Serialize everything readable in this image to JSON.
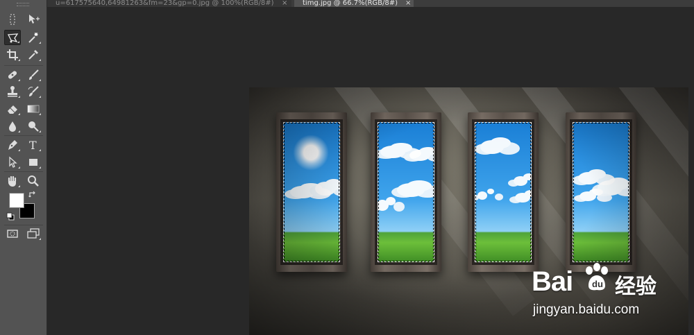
{
  "tabs": [
    {
      "label": "u=617575640,64981263&fm=23&gp=0.jpg @ 100%(RGB/8#)",
      "close": "×",
      "active": false
    },
    {
      "label": "timg.jpg @ 66.7%(RGB/8#)",
      "close": "×",
      "active": true
    }
  ],
  "tools": {
    "icons": [
      "marquee-icon",
      "move-icon",
      "polygonal-lasso-icon",
      "magic-wand-icon",
      "crop-icon",
      "eyedropper-icon",
      "spot-healing-brush-icon",
      "brush-icon",
      "clone-stamp-icon",
      "history-brush-icon",
      "eraser-icon",
      "gradient-icon",
      "blur-icon",
      "dodge-icon",
      "pen-icon",
      "type-icon",
      "path-selection-icon",
      "rectangle-shape-icon",
      "hand-icon",
      "zoom-icon",
      "swap-colors-icon",
      "default-colors-icon",
      "quick-mask-icon",
      "screen-mode-icon"
    ],
    "type_tool_glyph": "T",
    "active_tool": "polygonal-lasso-icon",
    "foreground_color": "#ffffff",
    "background_color": "#000000"
  },
  "document": {
    "windows": 4
  },
  "watermark": {
    "logo_text": "Bai",
    "logo_text_2": "du",
    "cn_text": "经验",
    "url": "jingyan.baidu.com"
  }
}
